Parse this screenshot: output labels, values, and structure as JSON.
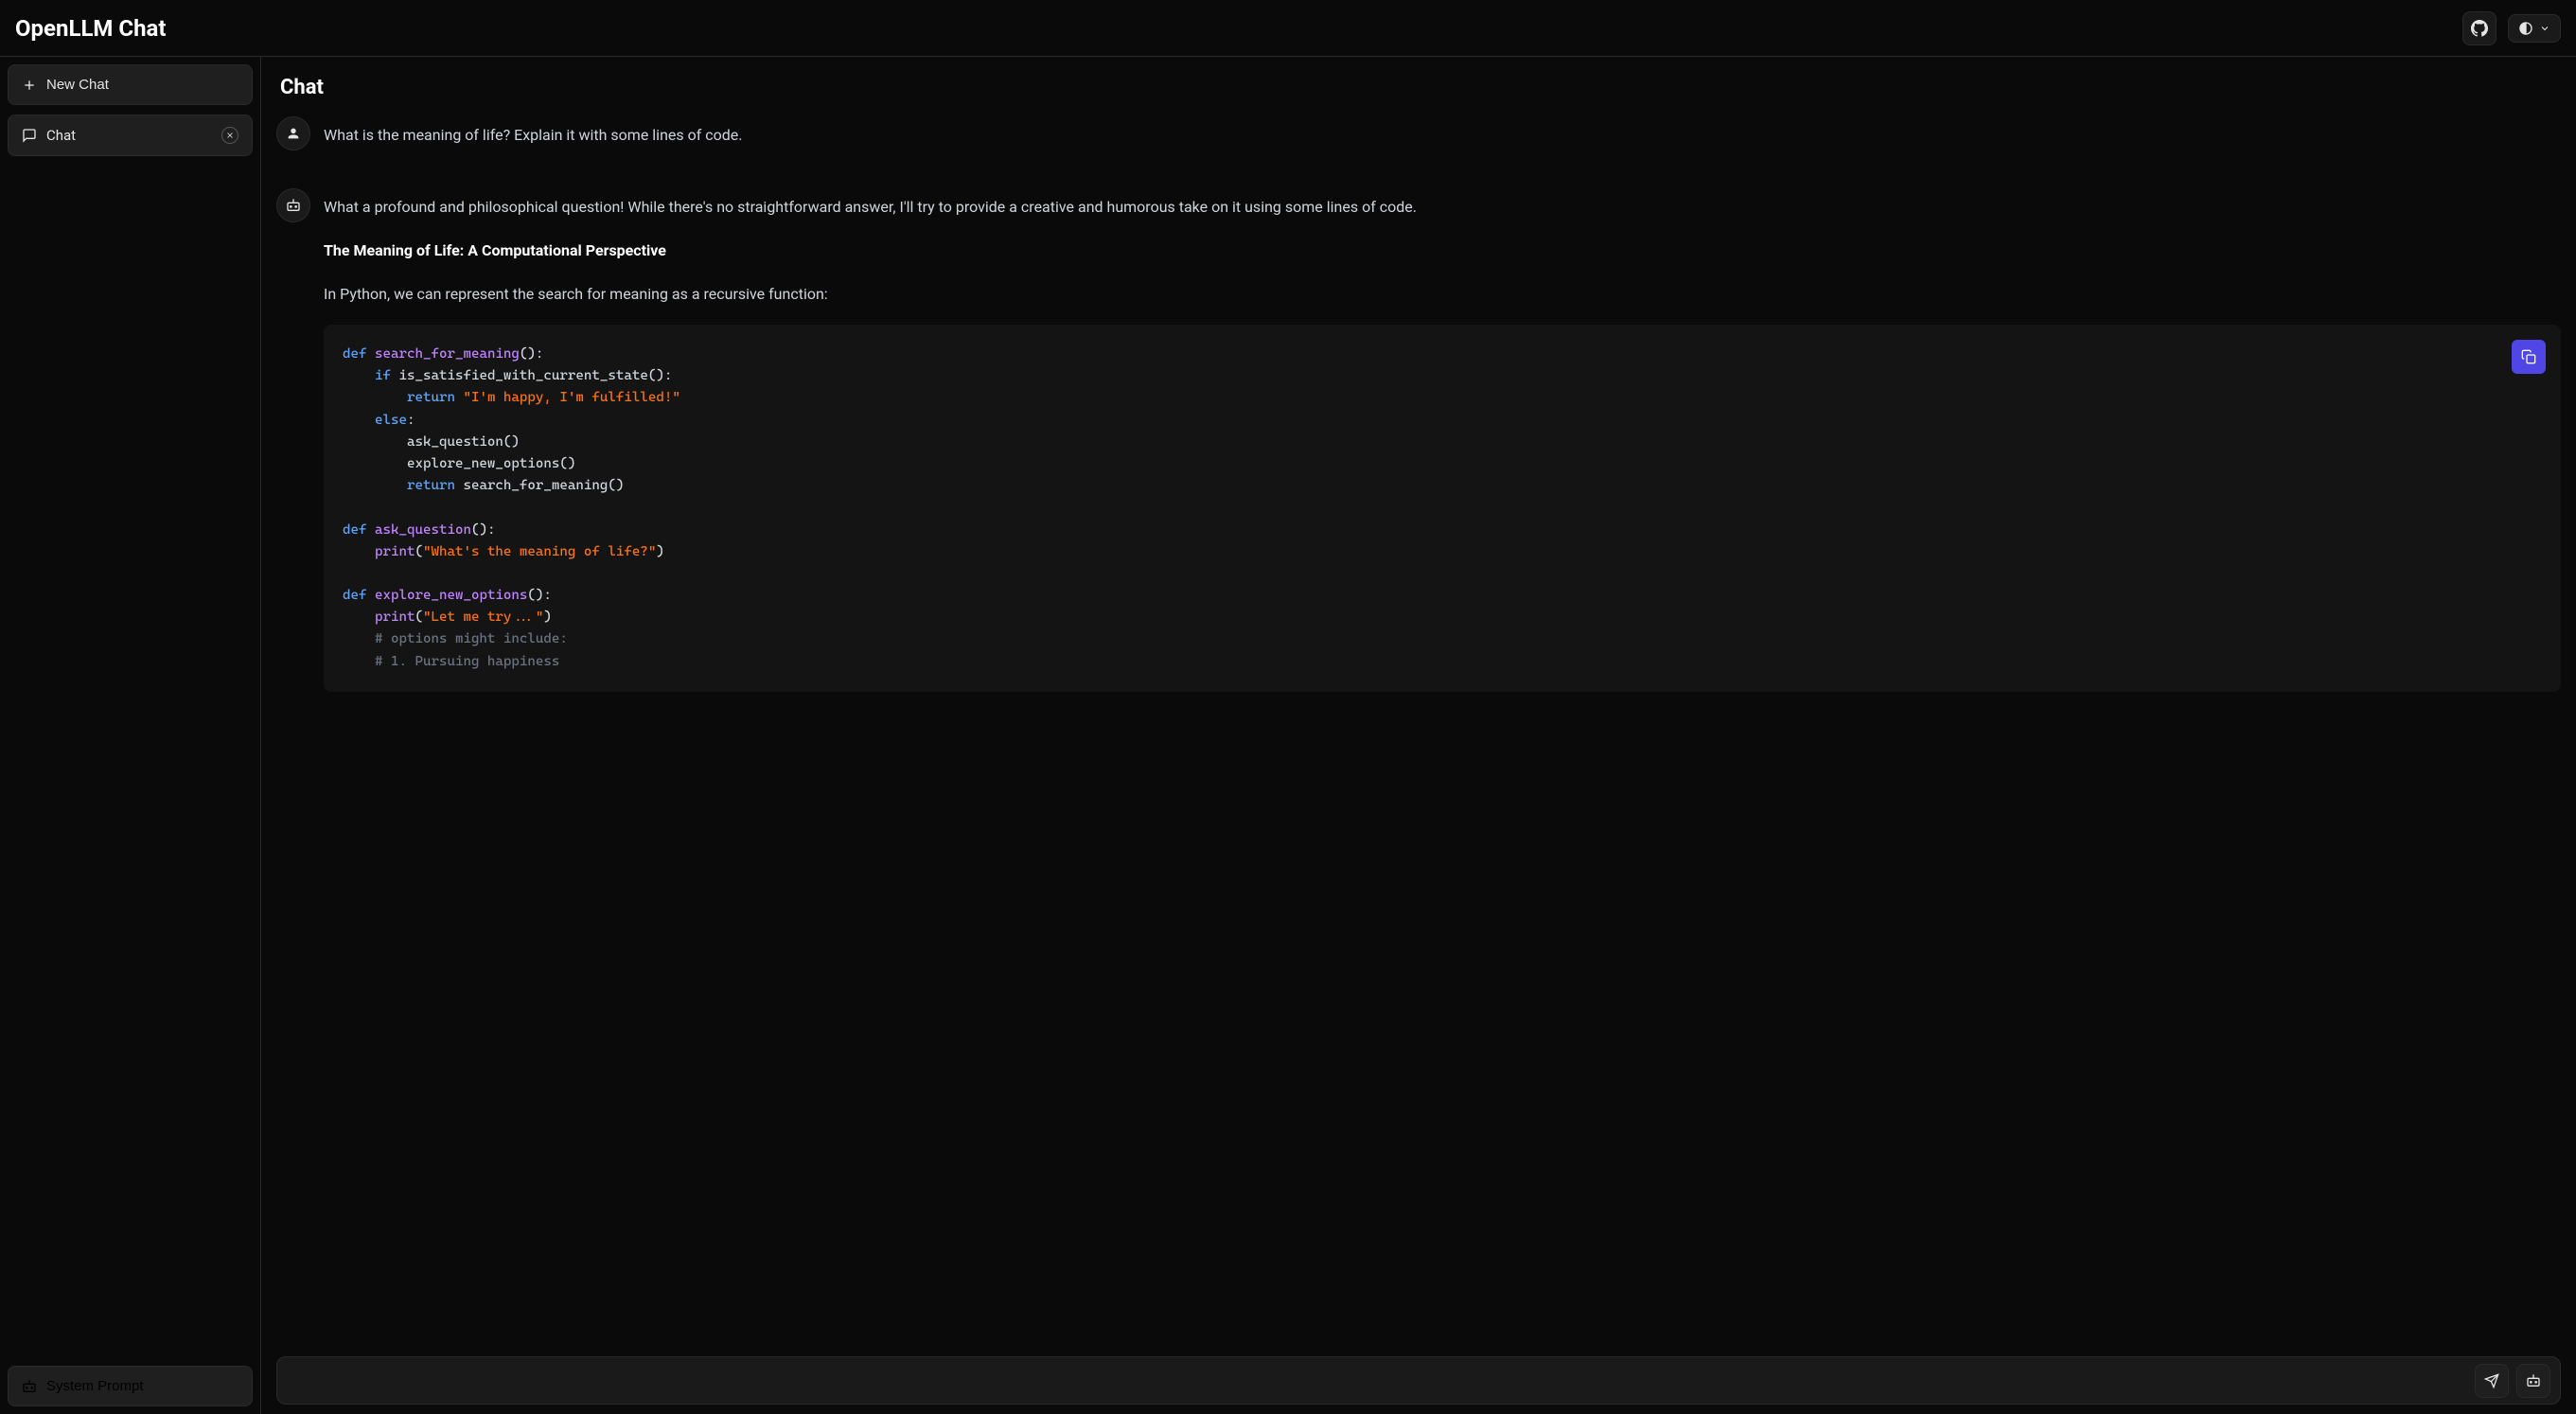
{
  "header": {
    "title": "OpenLLM Chat"
  },
  "sidebar": {
    "new_chat_label": "New Chat",
    "chat_item_label": "Chat",
    "system_prompt_label": "System Prompt"
  },
  "content": {
    "header": "Chat",
    "user_message": "What is the meaning of life? Explain it with some lines of code.",
    "bot_intro": "What a profound and philosophical question! While there's no straightforward answer, I'll try to provide a creative and humorous take on it using some lines of code.",
    "subtitle": "The Meaning of Life: A Computational Perspective",
    "python_intro": "In Python, we can represent the search for meaning as a recursive function:",
    "code": {
      "l1_def": "def",
      "l1_fn": " search_for_meaning",
      "l1_rest": "():",
      "l2_if": "    if",
      "l2_rest": " is_satisfied_with_current_state():",
      "l3_ret": "        return",
      "l3_str": " \"I'm happy, I'm fulfilled!\"",
      "l4_else": "    else",
      "l4_rest": ":",
      "l5": "        ask_question()",
      "l6": "        explore_new_options()",
      "l7_ret": "        return",
      "l7_rest": " search_for_meaning()",
      "l8_def": "def",
      "l8_fn": " ask_question",
      "l8_rest": "():",
      "l9_print": "    print",
      "l9_open": "(",
      "l9_str": "\"What's the meaning of life?\"",
      "l9_close": ")",
      "l10_def": "def",
      "l10_fn": " explore_new_options",
      "l10_rest": "():",
      "l11_print": "    print",
      "l11_open": "(",
      "l11_str": "\"Let me try...\"",
      "l11_close": ")",
      "l12": "    # options might include:",
      "l13": "    # 1. Pursuing happiness"
    }
  },
  "input": {
    "placeholder": ""
  }
}
